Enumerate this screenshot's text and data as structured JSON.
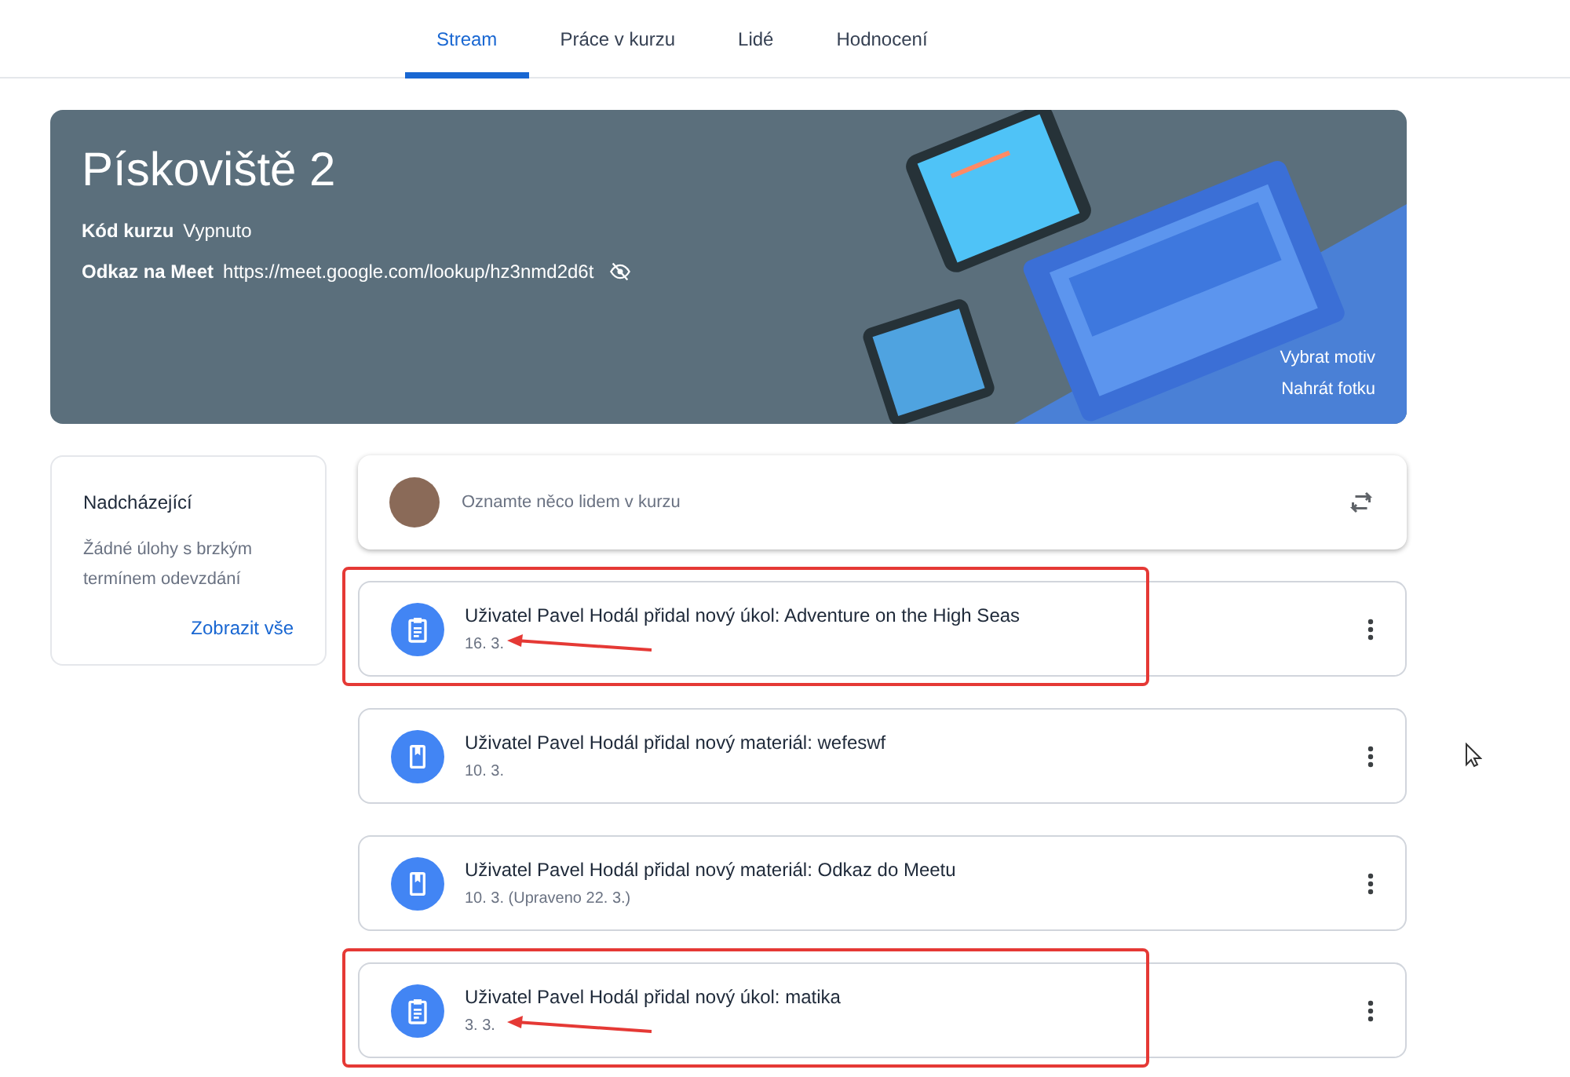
{
  "tabs": [
    {
      "label": "Stream",
      "selected": true
    },
    {
      "label": "Práce v kurzu",
      "selected": false
    },
    {
      "label": "Lidé",
      "selected": false
    },
    {
      "label": "Hodnocení",
      "selected": false
    }
  ],
  "banner": {
    "title": "Pískoviště 2",
    "code_label": "Kód kurzu",
    "code_value": "Vypnuto",
    "meet_label": "Odkaz na Meet",
    "meet_link": "https://meet.google.com/lookup/hz3nmd2d6t",
    "actions": [
      "Vybrat motiv",
      "Nahrát fotku"
    ]
  },
  "upcoming": {
    "title": "Nadcházející",
    "text": "Žádné úlohy s brzkým termínem odevzdání",
    "link": "Zobrazit vše"
  },
  "announce": {
    "placeholder": "Oznamte něco lidem v kurzu"
  },
  "posts": [
    {
      "kind": "assignment",
      "title": "Uživatel Pavel Hodál přidal nový úkol: Adventure on the High Seas",
      "date": "16. 3.",
      "annotated": true
    },
    {
      "kind": "material",
      "title": "Uživatel Pavel Hodál přidal nový materiál: wefeswf",
      "date": "10. 3.",
      "annotated": false
    },
    {
      "kind": "material",
      "title": "Uživatel Pavel Hodál přidal nový materiál: Odkaz do Meetu",
      "date": "10. 3. (Upraveno 22. 3.)",
      "annotated": false
    },
    {
      "kind": "assignment",
      "title": "Uživatel Pavel Hodál přidal nový úkol: matika",
      "date": "3. 3.",
      "annotated": true
    }
  ]
}
